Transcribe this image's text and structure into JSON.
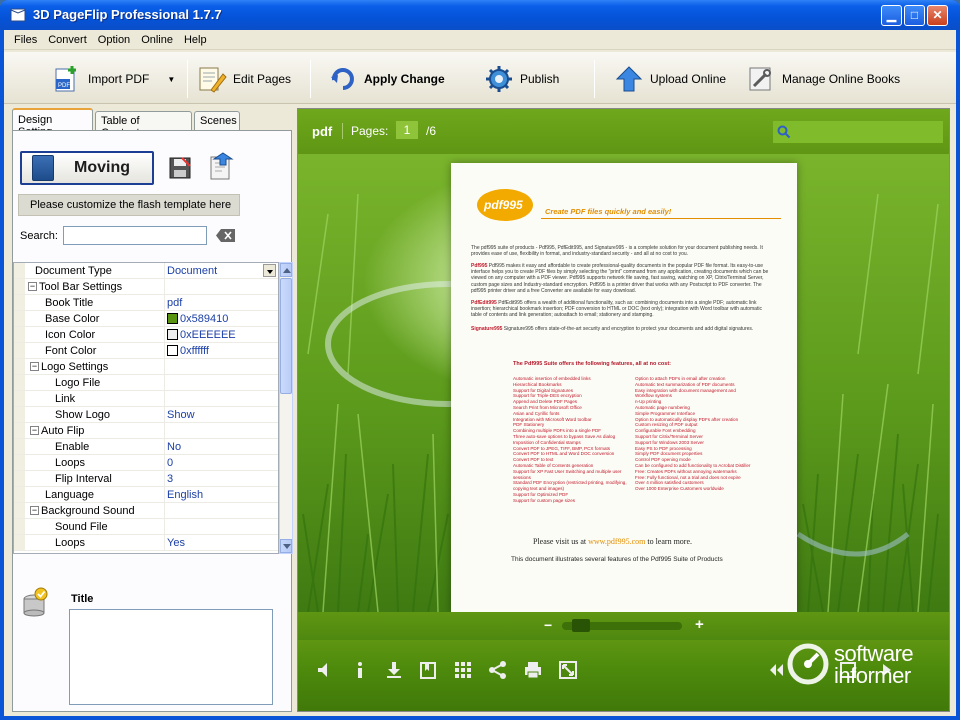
{
  "window": {
    "title": "3D PageFlip Professional 1.7.7"
  },
  "menu": [
    "Files",
    "Convert",
    "Option",
    "Online",
    "Help"
  ],
  "toolbar": {
    "import_pdf": "Import PDF",
    "edit_pages": "Edit Pages",
    "apply_change": "Apply Change",
    "publish": "Publish",
    "upload_online": "Upload Online",
    "manage_online_books": "Manage Online Books"
  },
  "left": {
    "tabs": [
      "Design Setting",
      "Table of Contents",
      "Scenes"
    ],
    "template_button": "Moving",
    "customize_text": "Please customize the flash template here",
    "search_label": "Search:",
    "search_value": "",
    "title_label": "Title",
    "title_value": ""
  },
  "properties": [
    {
      "key": "Document Type",
      "value": "Document",
      "indent": 1,
      "dropdown": true
    },
    {
      "key": "Tool Bar Settings",
      "value": "",
      "indent": 0,
      "group": true
    },
    {
      "key": "Book Title",
      "value": "pdf",
      "indent": 2
    },
    {
      "key": "Base Color",
      "value": "0x589410",
      "indent": 2,
      "swatch": "#589410"
    },
    {
      "key": "Icon Color",
      "value": "0xEEEEEE",
      "indent": 2,
      "swatch": "#EEEEEE"
    },
    {
      "key": "Font Color",
      "value": "0xffffff",
      "indent": 2,
      "swatch": "#ffffff"
    },
    {
      "key": "Logo Settings",
      "value": "",
      "indent": 1,
      "group": true
    },
    {
      "key": "Logo File",
      "value": "",
      "indent": 3
    },
    {
      "key": "Link",
      "value": "",
      "indent": 3
    },
    {
      "key": "Show Logo",
      "value": "Show",
      "indent": 3
    },
    {
      "key": "Auto Flip",
      "value": "",
      "indent": 1,
      "group": true
    },
    {
      "key": "Enable",
      "value": "No",
      "indent": 3
    },
    {
      "key": "Loops",
      "value": "0",
      "indent": 3
    },
    {
      "key": "Flip Interval",
      "value": "3",
      "indent": 3
    },
    {
      "key": "Language",
      "value": "English",
      "indent": 2
    },
    {
      "key": "Background Sound",
      "value": "",
      "indent": 1,
      "group": true
    },
    {
      "key": "Sound File",
      "value": "",
      "indent": 3
    },
    {
      "key": "Loops",
      "value": "Yes",
      "indent": 3
    }
  ],
  "preview": {
    "book_title": "pdf",
    "pages_label": "Pages:",
    "current_page": "1",
    "total_pages": "/6",
    "page": {
      "logo_text": "pdf995",
      "tagline": "Create PDF files quickly and easily!",
      "paragraphs": [
        "The pdf995 suite of products - Pdf995, PdfEdit995, and Signature995 - is a complete solution for your document publishing needs. It provides ease of use, flexibility in format, and industry-standard security - and all at no cost to you.",
        "Pdf995 makes it easy and affordable to create professional-quality documents in the popular PDF file format. Its easy-to-use interface helps you to create PDF files by simply selecting the \"print\" command from any application, creating documents which can be viewed on any computer with a PDF viewer. Pdf995 supports network file saving, fast saving, watching on XP, Citrix/Terminal Server, custom page sizes and Industry-standard encryption. Pdf995 is a printer driver that works with any Postscript to PDF converter. The pdf995 printer driver and a free Converter are available for easy download.",
        "PdfEdit995 offers a wealth of additional functionality, such as: combining documents into a single PDF; automatic link insertion; hierarchical bookmark insertion; PDF conversion to HTML or DOC (text only); integration with Word toolbar with automatic table of contents and link generation; autoattach to email; stationery and stamping.",
        "Signature995 offers state-of-the-art security and encryption to protect your documents and add digital signatures."
      ],
      "features_title": "The Pdf995 Suite offers the following features, all at no cost:",
      "features_left": [
        "Automatic insertion of embedded links",
        "Hierarchical Bookmarks",
        "Support for Digital Signatures",
        "Support for Triple-DES encryption",
        "Append and Delete PDF Pages",
        "Search Print from Microsoft Office",
        "Asian and Cyrillic fonts",
        "Integration with Microsoft Word toolbar",
        "PDF Stationery",
        "Combining multiple PDFs into a single PDF",
        "Three auto-save options to bypass Save As dialog",
        "Imposition of Confidential stamps",
        "Convert PDF to JPEG, TIFF, BMP, PCX formats",
        "Convert PDF to HTML and Word DOC conversion",
        "Convert PDF to text",
        "Automatic Table of Contents generation",
        "Support for XP Fast User Switching and multiple user sessions",
        "Standard PDF Encryption (restricted printing, modifying, copying text and images)",
        "Support for Optimized PDF",
        "Support for custom page sizes"
      ],
      "features_right": [
        "Option to attach PDFs in email after creation",
        "Automatic text summarization of PDF documents",
        "Easy integration with document management and Workflow systems",
        "n-Up printing",
        "Automatic page numbering",
        "Simple Programmer Interface",
        "Option to automatically display PDFs after creation",
        "Custom resizing of PDF output",
        "Configurable Font embedding",
        "Support for Citrix/Terminal Server",
        "Support for Windows 2003 Server",
        "Easy PS to PDF processing",
        "Simply PDF document properties",
        "Control PDF opening mode",
        "Can be configured to add functionality to Acrobat Distiller",
        "Free: Creates PDFs without annoying watermarks",
        "Free: Fully functional, not a trial and does not expire",
        "Over 4 million satisfied customers",
        "Over 1000 Enterprise Customers worldwide"
      ],
      "visit_text": "Please visit us at",
      "visit_link": "www.pdf995.com",
      "visit_tail": "to learn more.",
      "illustrates": "This document illustrates several features of the Pdf995 Suite of Products"
    },
    "zoom_minus": "−",
    "zoom_plus": "+",
    "zoom_level": 0.1
  },
  "watermark": {
    "line1": "software",
    "line2": "informer"
  },
  "colors": {
    "base": "#589410",
    "icon": "#EEEEEE",
    "font": "#ffffff",
    "accent_title": "#0553d8"
  }
}
